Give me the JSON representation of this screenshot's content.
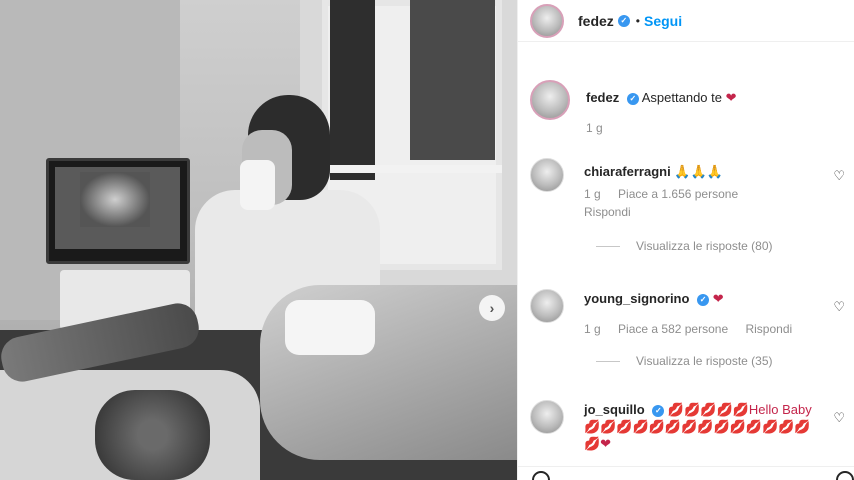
{
  "post": {
    "next_arrow": "›"
  },
  "header": {
    "username": "fedez",
    "separator": "•",
    "follow_label": "Segui"
  },
  "caption": {
    "username": "fedez",
    "text": "Aspettando te",
    "emoji": "❤",
    "time": "1 g"
  },
  "comments": [
    {
      "username": "chiaraferragni",
      "text": "🙏🙏🙏",
      "time": "1 g",
      "likes": "Piace a 1.656 persone",
      "reply_label": "Rispondi",
      "view_replies": "Visualizza le risposte (80)"
    },
    {
      "username": "young_signorino",
      "text": "❤",
      "time": "1 g",
      "likes": "Piace a 582 persone",
      "reply_label": "Rispondi",
      "view_replies": "Visualizza le risposte (35)"
    },
    {
      "username": "jo_squillo",
      "text": "💋💋💋💋💋Hello Baby 💋💋💋💋💋💋💋💋💋💋💋💋💋💋💋❤"
    }
  ],
  "icons": {
    "verified": "✓",
    "like": "♡"
  }
}
